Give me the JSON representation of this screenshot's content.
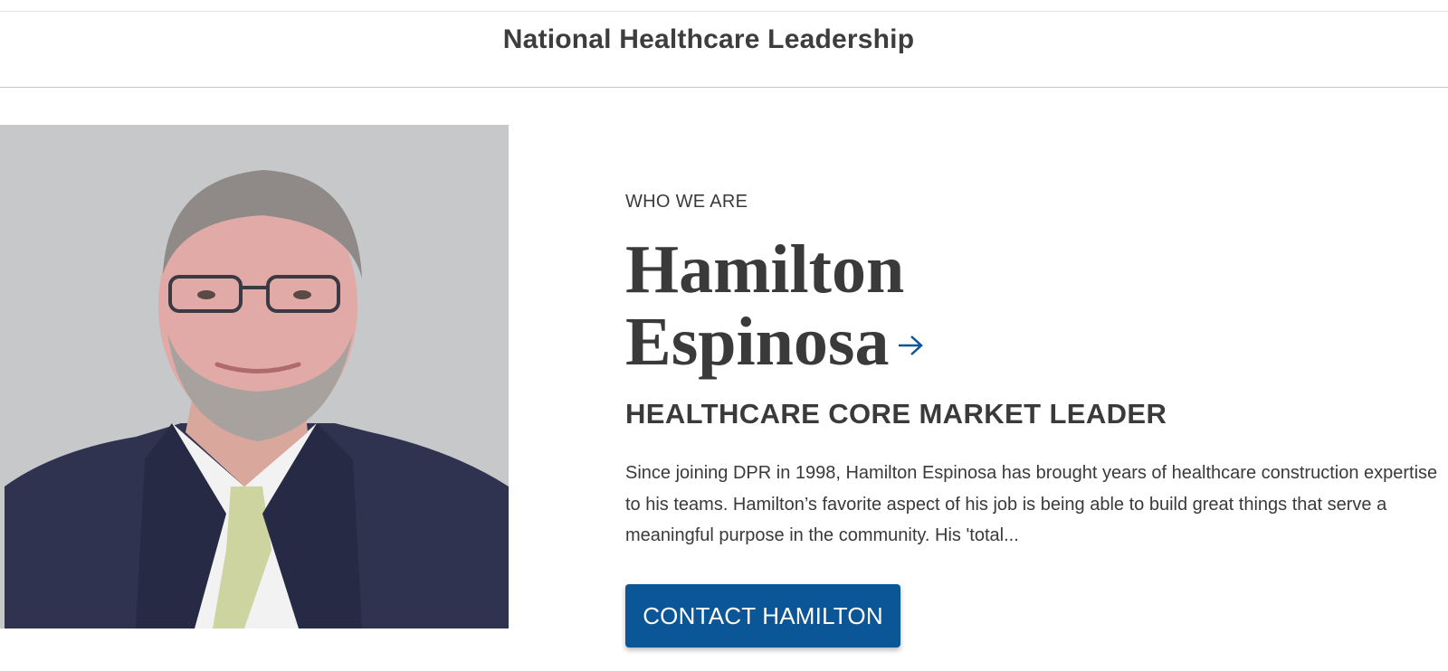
{
  "header": {
    "title": "National Healthcare Leadership"
  },
  "profile": {
    "eyebrow": "WHO WE ARE",
    "first_name": "Hamilton",
    "last_name": "Espinosa",
    "arrow_icon": "arrow-right-icon",
    "role": "HEALTHCARE CORE MARKET LEADER",
    "bio": "Since joining DPR in 1998, Hamilton Espinosa has brought years of healthcare construction expertise to his teams. Hamilton’s favorite aspect of his job is being able to build great things that serve a meaningful purpose in the community. His 'total...",
    "cta_label": "CONTACT HAMILTON"
  },
  "colors": {
    "accent": "#0b5696",
    "text": "#3a3a3a",
    "portrait_bg": "#c6c8ca"
  }
}
